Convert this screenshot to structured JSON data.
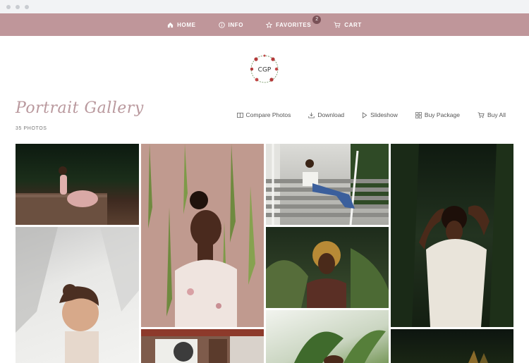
{
  "nav": {
    "home": "HOME",
    "info": "INFO",
    "favorites": "FAVORITES",
    "favorites_count": "2",
    "cart": "CART"
  },
  "logo": {
    "text": "CGP"
  },
  "gallery": {
    "title": "Portrait Gallery",
    "count": "35 PHOTOS"
  },
  "actions": {
    "compare": "Compare Photos",
    "download": "Download",
    "slideshow": "Slideshow",
    "buy_package": "Buy Package",
    "buy_all": "Buy All"
  },
  "colors": {
    "nav_bg": "#bf969a",
    "title": "#b9989d"
  }
}
